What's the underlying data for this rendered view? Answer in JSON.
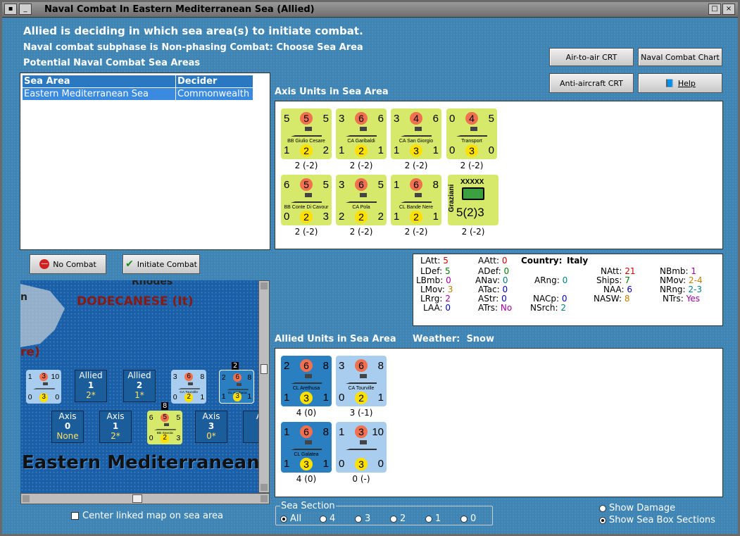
{
  "window": {
    "title": "Naval Combat In Eastern Mediterranean Sea (Allied)"
  },
  "header": {
    "line1": "Allied is deciding in which sea area(s) to initiate combat.",
    "line2": "Naval combat subphase is Non-phasing Combat: Choose Sea Area",
    "line3": "Potential Naval Combat Sea Areas"
  },
  "crt_buttons": {
    "air_to_air": "Air-to-air CRT",
    "naval_chart": "Naval Combat Chart",
    "anti_aircraft": "Anti-aircraft CRT",
    "help": "Help"
  },
  "sea_area_table": {
    "columns": [
      "Sea Area",
      "Decider"
    ],
    "rows": [
      [
        "Eastern Mediterranean Sea",
        "Commonwealth"
      ]
    ]
  },
  "actions": {
    "no_combat": "No Combat",
    "initiate_combat": "Initiate Combat"
  },
  "axis_section": {
    "label": "Axis Units in Sea Area",
    "units": [
      {
        "tl": "5",
        "tc": "5",
        "tr": "5",
        "name": "BB Giulio Cesare",
        "bl": "1",
        "bc": "2",
        "br": "2",
        "strength": "2 (-2)"
      },
      {
        "tl": "3",
        "tc": "6",
        "tr": "6",
        "name": "CA Garibaldi",
        "bl": "1",
        "bc": "2",
        "br": "1",
        "strength": "2 (-2)"
      },
      {
        "tl": "3",
        "tc": "4",
        "tr": "6",
        "name": "CA San Giorgio",
        "bl": "1",
        "bc": "3",
        "br": "1",
        "strength": "2 (-2)"
      },
      {
        "tl": "0",
        "tc": "4",
        "tr": "5",
        "name": "Transport",
        "bl": "0",
        "bc": "3",
        "br": "0",
        "strength": "2 (-2)"
      },
      {
        "tl": "6",
        "tc": "5",
        "tr": "5",
        "name": "BB Conte Di Cavour",
        "bl": "0",
        "bc": "2",
        "br": "3",
        "strength": "2 (-2)"
      },
      {
        "tl": "3",
        "tc": "6",
        "tr": "5",
        "name": "CA Pola",
        "bl": "2",
        "bc": "2",
        "br": "2",
        "strength": "2 (-2)"
      },
      {
        "tl": "1",
        "tc": "6",
        "tr": "8",
        "name": "CL Bande Nere",
        "bl": "1",
        "bc": "2",
        "br": "1",
        "strength": "2 (-2)"
      }
    ],
    "army": {
      "side_name": "Graziani",
      "size": "XXXXX",
      "value": "5(2)3",
      "strength": "2 (-2)"
    }
  },
  "stats": {
    "country_label": "Country:",
    "country": "Italy",
    "LAtt": "5",
    "LDef": "5",
    "LBmb": "0",
    "LMov": "3",
    "LRrg": "2",
    "LAA": "0",
    "AAtt": "0",
    "ADef": "0",
    "ANav": "0",
    "ATac": "0",
    "AStr": "0",
    "ATrs": "No",
    "ARng": "0",
    "NACp": "0",
    "NSrch": "2",
    "NAtt": "21",
    "Ships": "7",
    "NAA": "6",
    "NASW": "8",
    "NBmb": "1",
    "NMov": "2-4",
    "NRng": "2-3",
    "NTrs": "Yes",
    "colors": {
      "red": "#d00000",
      "green": "#008000",
      "blue": "#0000c0",
      "purple": "#a000a0",
      "teal": "#008080",
      "orange": "#c08000"
    }
  },
  "allied_section": {
    "label": "Allied Units in Sea Area",
    "weather_label": "Weather:",
    "weather": "Snow",
    "units": [
      {
        "tl": "2",
        "tc": "6",
        "tr": "8",
        "name": "CL Arethusa",
        "bl": "1",
        "bc": "3",
        "br": "1",
        "strength": "4 (0)",
        "style": "allied"
      },
      {
        "tl": "3",
        "tc": "6",
        "tr": "8",
        "name": "CA Tourville",
        "bl": "0",
        "bc": "2",
        "br": "1",
        "strength": "3 (-1)",
        "style": "allied-light"
      },
      {
        "tl": "1",
        "tc": "6",
        "tr": "8",
        "name": "CL Galatea",
        "bl": "1",
        "bc": "3",
        "br": "1",
        "strength": "4 (0)",
        "style": "allied"
      },
      {
        "tl": "1",
        "tc": "3",
        "tr": "10",
        "name": "",
        "bl": "0",
        "bc": "3",
        "br": "0",
        "strength": "0 (-)",
        "style": "allied-light"
      }
    ]
  },
  "map": {
    "region": "DODECANESE (It)",
    "rhodes": "Rhodes",
    "left_n": "n",
    "left_re": "re)",
    "sea_name": "Eastern Mediterranean",
    "allied_boxes": [
      {
        "label": "Allied",
        "num": "1",
        "val": "2*"
      },
      {
        "label": "Allied",
        "num": "2",
        "val": "1*"
      }
    ],
    "axis_boxes": [
      {
        "label": "Axis",
        "num": "0",
        "val": "None"
      },
      {
        "label": "Axis",
        "num": "1",
        "val": "2*"
      },
      {
        "label": "Axis",
        "num": "3",
        "val": "0*"
      },
      {
        "label": "A",
        "num": "",
        "val": ""
      }
    ],
    "counter_badges": [
      "2",
      "8"
    ],
    "small_counter": {
      "tl": "1",
      "tc": "3",
      "tr": "10",
      "bl": "0",
      "bc": "3",
      "br": "0"
    },
    "tourville": {
      "tl": "3",
      "tc": "6",
      "tr": "8",
      "name": "CA Tourville",
      "bl": "0",
      "bc": "2",
      "br": "1"
    },
    "arethusa": {
      "tl": "2",
      "tc": "6",
      "tr": "8",
      "name": "CL Arethusa",
      "bl": "1",
      "bc": "3",
      "br": "1"
    },
    "savoia": {
      "tl": "6",
      "tc": "5",
      "tr": "5",
      "name": "BB Savoia",
      "bl": "0",
      "bc": "2",
      "br": "3"
    }
  },
  "footer": {
    "center_map": "Center linked map on sea area",
    "sea_section_label": "Sea Section",
    "sections": [
      "All",
      "4",
      "3",
      "2",
      "1",
      "0"
    ],
    "show_damage": "Show Damage",
    "show_sea_box": "Show Sea Box Sections"
  }
}
